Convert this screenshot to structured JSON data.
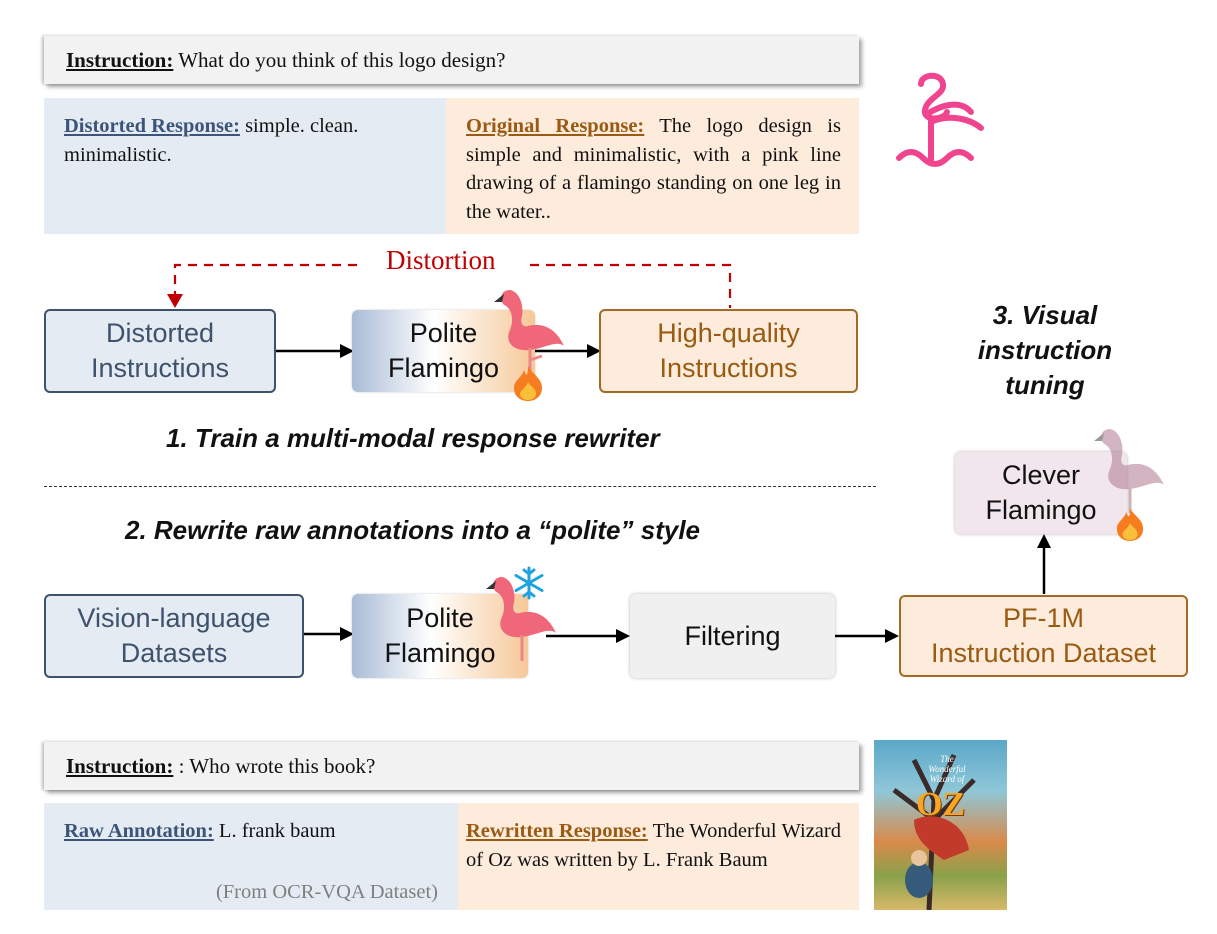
{
  "top_example": {
    "instruction_label": "Instruction:",
    "instruction_text": " What do you think of this logo design?",
    "distorted_label": "Distorted Response:",
    "distorted_text": " simple. clean. minimalistic.",
    "original_label": "Original Response:",
    "original_text": " The logo design is simple and minimalistic, with a pink line drawing of a flamingo standing on one leg in the water..",
    "image": "flamingo-logo-line-drawing"
  },
  "stage1": {
    "distortion_label": "Distortion",
    "distorted_box": [
      "Distorted",
      "Instructions"
    ],
    "polite_box": [
      "Polite",
      "Flamingo"
    ],
    "highquality_box": [
      "High-quality",
      "Instructions"
    ],
    "heading": "1. Train a multi-modal response rewriter",
    "model_state_icon": "fire-icon"
  },
  "stage2": {
    "heading": "2. Rewrite raw annotations into a “polite” style",
    "vl_box": [
      "Vision-language",
      "Datasets"
    ],
    "polite_box": [
      "Polite",
      "Flamingo"
    ],
    "filter_box": "Filtering",
    "dataset_box": [
      "PF-1M",
      "Instruction Dataset"
    ],
    "model_state_icon": "snowflake-icon"
  },
  "stage3": {
    "heading": [
      "3. Visual",
      "instruction",
      "tuning"
    ],
    "clever_box": [
      "Clever",
      "Flamingo"
    ],
    "model_state_icon": "fire-icon"
  },
  "bottom_example": {
    "instruction_label": "Instruction:",
    "instruction_text": " : Who wrote this book?",
    "raw_label": "Raw Annotation:",
    "raw_text": " L. frank baum",
    "source_note": "(From OCR-VQA Dataset)",
    "rewritten_label": "Rewritten Response:",
    "rewritten_text": " The Wonderful Wizard of Oz was written by L. Frank Baum",
    "book_cover": {
      "title_small": "The Wonderful Wizard of",
      "title_big": "OZ"
    }
  },
  "colors": {
    "blue_box": "#e4ebf3",
    "blue_border": "#3e526c",
    "orange_box": "#fdebdb",
    "orange_border": "#a36a25",
    "distortion_red": "#c00000",
    "logo_pink": "#f0458e"
  }
}
